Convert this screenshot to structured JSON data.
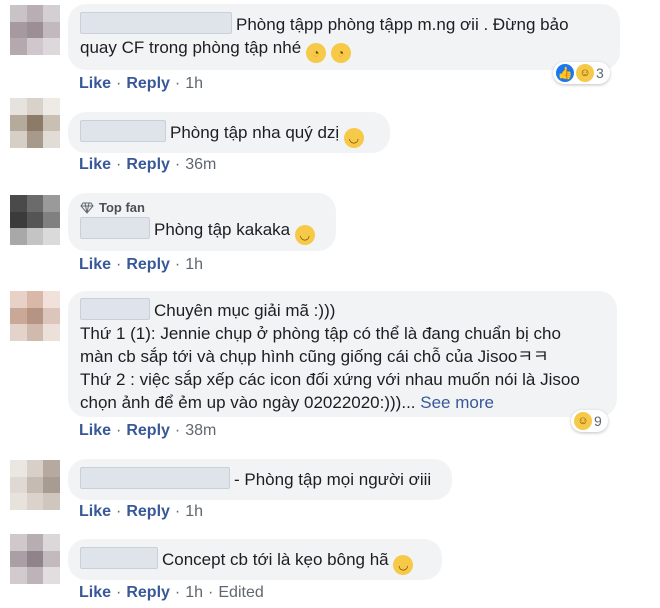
{
  "colors": {
    "link": "#385898",
    "meta": "#606770",
    "bubble": "#f2f3f5"
  },
  "comments": [
    {
      "text_lines": [
        "Phòng tậpp phòng tậpp m.ng ơii . Đừng bảo",
        "quay CF trong phòng tập nhé"
      ],
      "emojis": [
        "rolling-eyes-emoji",
        "rolling-eyes-emoji"
      ],
      "reactions": {
        "icons": [
          "like-icon",
          "haha-icon"
        ],
        "count": "3"
      },
      "like": "Like",
      "reply": "Reply",
      "time": "1h"
    },
    {
      "text_lines": [
        "Phòng tập nha quý dzị"
      ],
      "emojis": [
        "smirk-emoji"
      ],
      "like": "Like",
      "reply": "Reply",
      "time": "36m"
    },
    {
      "badge": "Top fan",
      "text_lines": [
        "Phòng tập kakaka"
      ],
      "emojis": [
        "grin-emoji"
      ],
      "like": "Like",
      "reply": "Reply",
      "time": "1h"
    },
    {
      "text_lines": [
        "Chuyên mục giải mã :)))",
        "Thứ 1 (1): Jennie chụp ở phòng tập có thể là đang chuẩn bị cho",
        "màn cb sắp tới và chụp hình cũng giống cái chỗ của Jisooㅋㅋ",
        "Thứ 2 : việc sắp xếp các icon đối xứng với nhau muốn nói là Jisoo",
        "chọn ảnh để ẻm up vào ngày 02022020:)))..."
      ],
      "see_more": "See more",
      "reactions": {
        "icons": [
          "haha-icon"
        ],
        "count": "9"
      },
      "like": "Like",
      "reply": "Reply",
      "time": "38m"
    },
    {
      "text_lines": [
        "- Phòng tập mọi người ơiii"
      ],
      "like": "Like",
      "reply": "Reply",
      "time": "1h"
    },
    {
      "text_lines": [
        "Concept cb tới là kẹo bông hã"
      ],
      "emojis": [
        "grin-emoji"
      ],
      "like": "Like",
      "reply": "Reply",
      "time": "1h",
      "edited": "Edited"
    }
  ]
}
